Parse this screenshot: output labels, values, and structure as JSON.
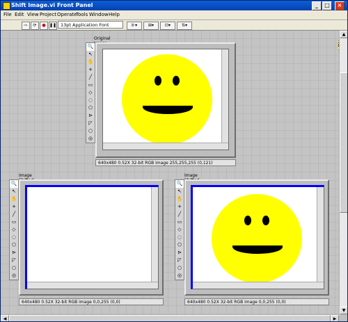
{
  "window": {
    "title": "Shift Image.vi Front Panel",
    "controls": {
      "minimize": "_",
      "maximize": "□",
      "close": "×"
    }
  },
  "menu": [
    "File",
    "Edit",
    "View",
    "Project",
    "Operate",
    "Tools",
    "Window",
    "Help"
  ],
  "toolbar": {
    "font_select": "13pt Application Font",
    "help": "?"
  },
  "palette_tools": [
    "zoom-icon",
    "arrow-icon",
    "pan-icon",
    "point-icon",
    "line-icon",
    "rectangle-icon",
    "rotated-rect-icon",
    "annulus-icon",
    "polygon-icon",
    "freehand-line-icon",
    "freehand-region-icon",
    "oval-icon",
    "spiral-icon"
  ],
  "images": [
    {
      "caption": "Original Image",
      "status": "640x480 0.52X 32-bit RGB image 255,255,255    (0,121)",
      "has_face": true,
      "border_color": "#ffffff"
    },
    {
      "caption": "Image Shifted",
      "status": "640x480 0.52X 32-bit RGB image 0,0,255    (0,0)",
      "has_face": false,
      "border_color": "#0000ff"
    },
    {
      "caption": "Image Shifted after Merge Overlay",
      "status": "640x480 0.52X 32-bit RGB image 0,0,255    (0,0)",
      "has_face": true,
      "border_color": "#0000ff"
    }
  ],
  "colors": {
    "face": "#ffff00",
    "shift_border": "#0000ff"
  }
}
